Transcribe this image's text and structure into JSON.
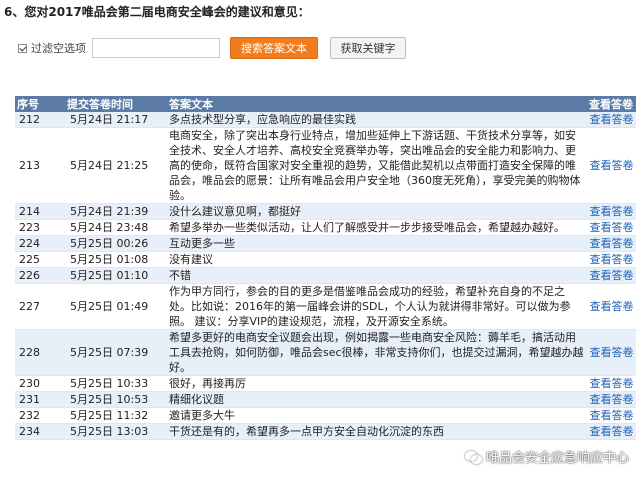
{
  "question": {
    "title": "6、您对2017唯品会第二届电商安全峰会的建议和意见："
  },
  "filter": {
    "checkbox_label": "过滤空选项",
    "search_value": "",
    "search_button": "搜索答案文本",
    "keyword_button": "获取关键字"
  },
  "table": {
    "headers": {
      "id": "序号",
      "time": "提交答卷时间",
      "answer": "答案文本",
      "view": "查看答卷"
    },
    "rows": [
      {
        "id": "212",
        "time": "5月24日 21:17",
        "answer": "多点技术型分享，应急响应的最佳实践",
        "view": "查看答卷"
      },
      {
        "id": "213",
        "time": "5月24日 21:25",
        "answer": "电商安全，除了突出本身行业特点，增加些延伸上下游话题、干货技术分享等，如安全技术、安全人才培养、高校安全竞赛举办等，突出唯品会的安全能力和影响力、更高的使命，既符合国家对安全重视的趋势，又能借此契机以点带面打造安全保障的唯品会，唯品会的愿景：让所有唯品会用户安全地（360度无死角），享受完美的购物体验。",
        "view": "查看答卷"
      },
      {
        "id": "214",
        "time": "5月24日 21:39",
        "answer": "没什么建议意见啊，都挺好",
        "view": "查看答卷"
      },
      {
        "id": "223",
        "time": "5月24日 23:48",
        "answer": "希望多举办一些类似活动，让人们了解感受并一步步接受唯品会，希望越办越好。",
        "view": "查看答卷"
      },
      {
        "id": "224",
        "time": "5月25日 00:26",
        "answer": "互动更多一些",
        "view": "查看答卷"
      },
      {
        "id": "225",
        "time": "5月25日 01:08",
        "answer": "没有建议",
        "view": "查看答卷"
      },
      {
        "id": "226",
        "time": "5月25日 01:10",
        "answer": "不错",
        "view": "查看答卷"
      },
      {
        "id": "227",
        "time": "5月25日 01:49",
        "answer": "作为甲方同行，参会的目的更多是借鉴唯品会成功的经验，希望补充自身的不足之处。比如说：2016年的第一届峰会讲的SDL，个人认为就讲得非常好。可以做为参照。 建议：分享VIP的建设规范，流程，及开源安全系统。",
        "view": "查看答卷"
      },
      {
        "id": "228",
        "time": "5月25日 07:39",
        "answer": "希望多更好的电商安全议题会出现，例如揭露一些电商安全风险：薅羊毛，搞活动用工具去抢购，如何防御，唯品会sec很棒，非常支持你们，也提交过漏洞，希望越办越好。",
        "view": "查看答卷"
      },
      {
        "id": "230",
        "time": "5月25日 10:33",
        "answer": "很好，再接再厉",
        "view": "查看答卷"
      },
      {
        "id": "231",
        "time": "5月25日 10:53",
        "answer": "精细化议题",
        "view": "查看答卷"
      },
      {
        "id": "232",
        "time": "5月25日 11:32",
        "answer": "邀请更多大牛",
        "view": "查看答卷"
      },
      {
        "id": "234",
        "time": "5月25日 13:03",
        "answer": "干货还是有的，希望再多一点甲方安全自动化沉淀的东西",
        "view": "查看答卷"
      }
    ]
  },
  "watermark": {
    "text": "唯品会安全应急响应中心",
    "icon": "wechat-icon"
  }
}
